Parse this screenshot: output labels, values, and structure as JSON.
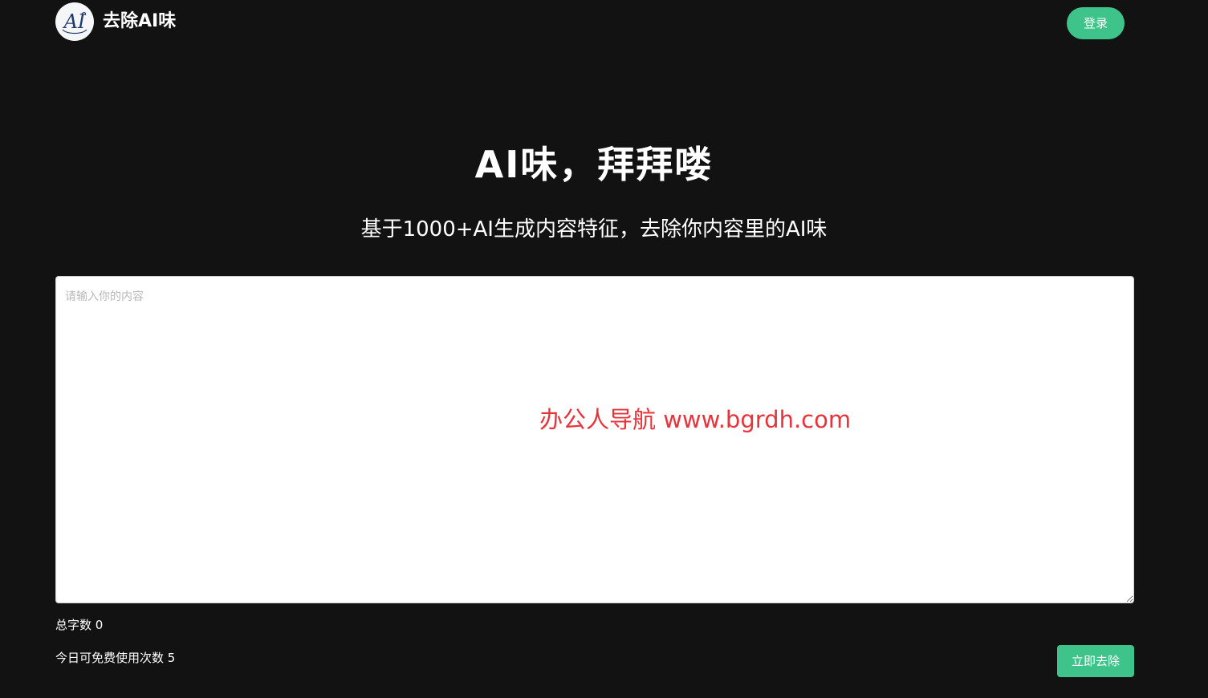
{
  "header": {
    "logo_text": "AI",
    "brand": "去除AI味",
    "login_label": "登录"
  },
  "hero": {
    "title": "AI味，拜拜喽",
    "subtitle": "基于1000+AI生成内容特征，去除你内容里的AI味"
  },
  "editor": {
    "placeholder": "请输入你的内容",
    "value": ""
  },
  "watermark": "办公人导航 www.bgrdh.com",
  "stats": {
    "word_count_label": "总字数",
    "word_count": "0",
    "free_uses_label": "今日可免费使用次数",
    "free_uses": "5"
  },
  "actions": {
    "remove_label": "立即去除"
  },
  "colors": {
    "background": "#121212",
    "accent": "#3ec48a",
    "watermark": "#e8333a"
  }
}
